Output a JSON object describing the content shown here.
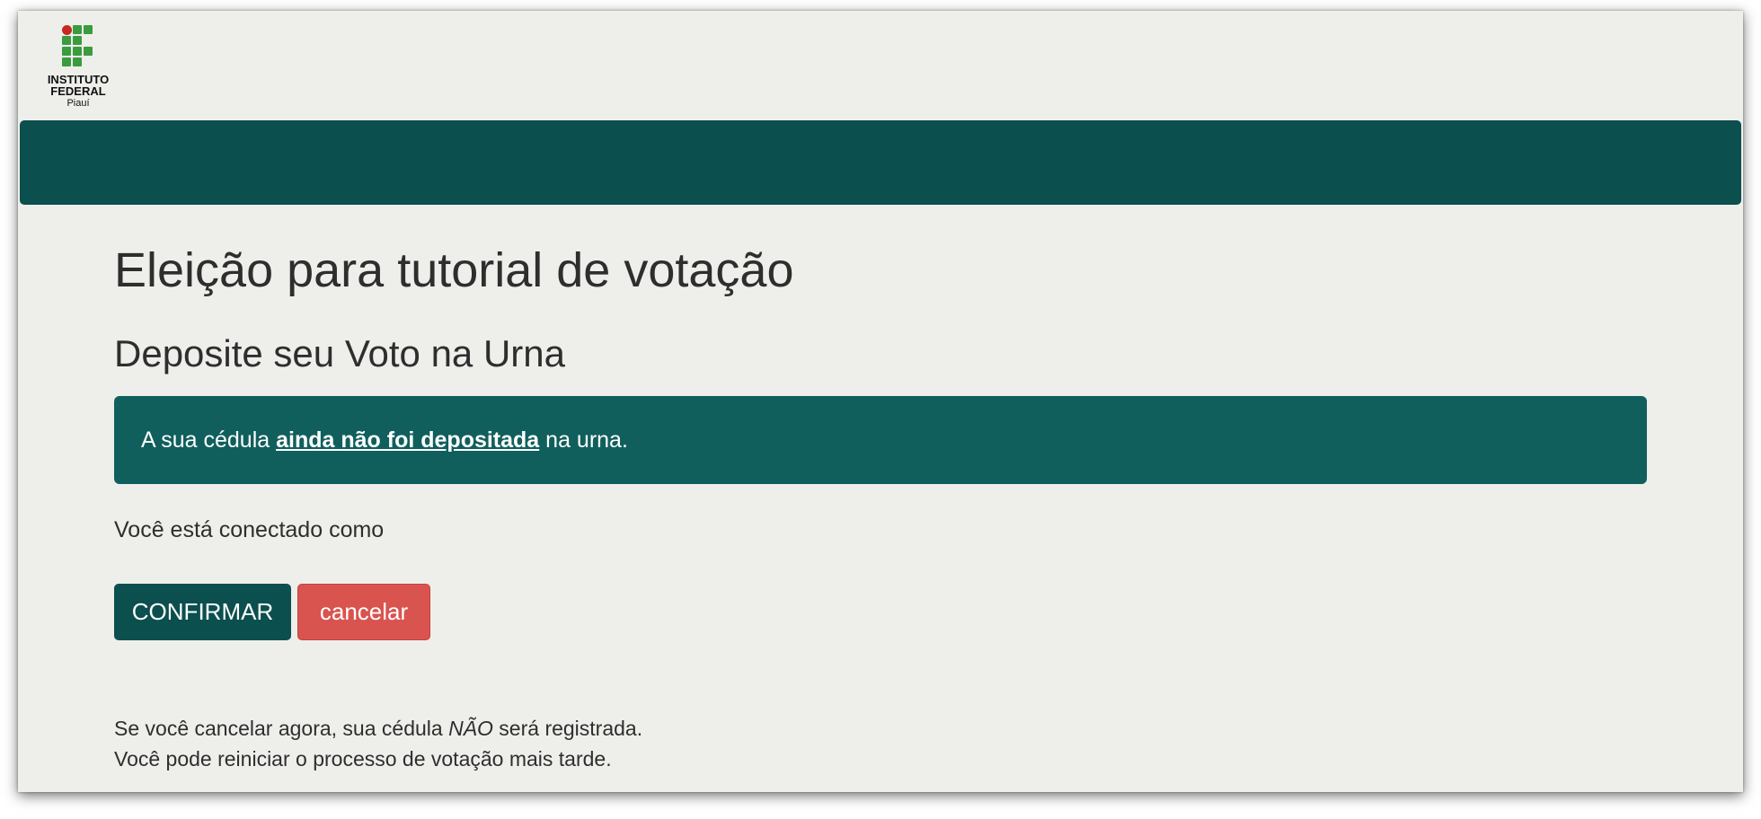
{
  "logo": {
    "line1": "INSTITUTO",
    "line2": "FEDERAL",
    "line3": "Piauí"
  },
  "page": {
    "title": "Eleição para tutorial de votação",
    "subtitle": "Deposite seu Voto na Urna"
  },
  "alert": {
    "prefix": "A sua cédula ",
    "emphasis": "ainda não foi depositada",
    "suffix": " na urna."
  },
  "connected": {
    "label": "Você está conectado como"
  },
  "buttons": {
    "confirm": "CONFIRMAR",
    "cancel": "cancelar"
  },
  "notes": {
    "line1_prefix": "Se você cancelar agora, sua cédula ",
    "line1_emphasis": "NÃO",
    "line1_suffix": " será registrada.",
    "line2": "Você pode reiniciar o processo de votação mais tarde."
  },
  "colors": {
    "primary": "#0b4f4e",
    "alert": "#105f5d",
    "danger": "#d9534f",
    "logo_green": "#3b9b3f",
    "logo_red": "#c8281f",
    "background": "#eeefeb"
  }
}
